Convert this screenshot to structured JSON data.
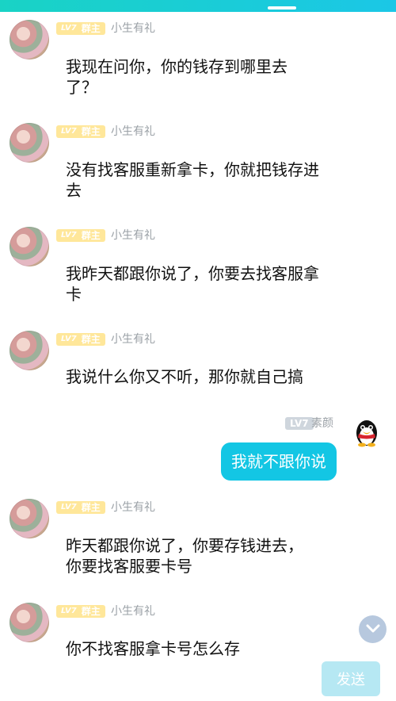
{
  "badges": {
    "level": "LV7",
    "admin": "群主"
  },
  "messages": [
    {
      "sender": "小生有礼",
      "text": "我现在问你，你的钱存到哪里去了？"
    },
    {
      "sender": "小生有礼",
      "text": "没有找客服重新拿卡，你就把钱存进去"
    },
    {
      "sender": "小生有礼",
      "text": "我昨天都跟你说了，你要去找客服拿卡"
    },
    {
      "sender": "小生有礼",
      "text": "我说什么你又不听，那你就自己搞"
    },
    {
      "sender": "素颜",
      "text": "我就不跟你说",
      "self": true
    },
    {
      "sender": "小生有礼",
      "text": "昨天都跟你说了，你要存钱进去，你要找客服要卡号"
    },
    {
      "sender": "小生有礼",
      "text": "你不找客服拿卡号怎么存"
    }
  ],
  "input": {
    "send_label": "发送"
  },
  "icons": {
    "avatar": "avatar-photo",
    "penguin": "qq-penguin-icon",
    "scroll": "chevron-down-icon"
  }
}
